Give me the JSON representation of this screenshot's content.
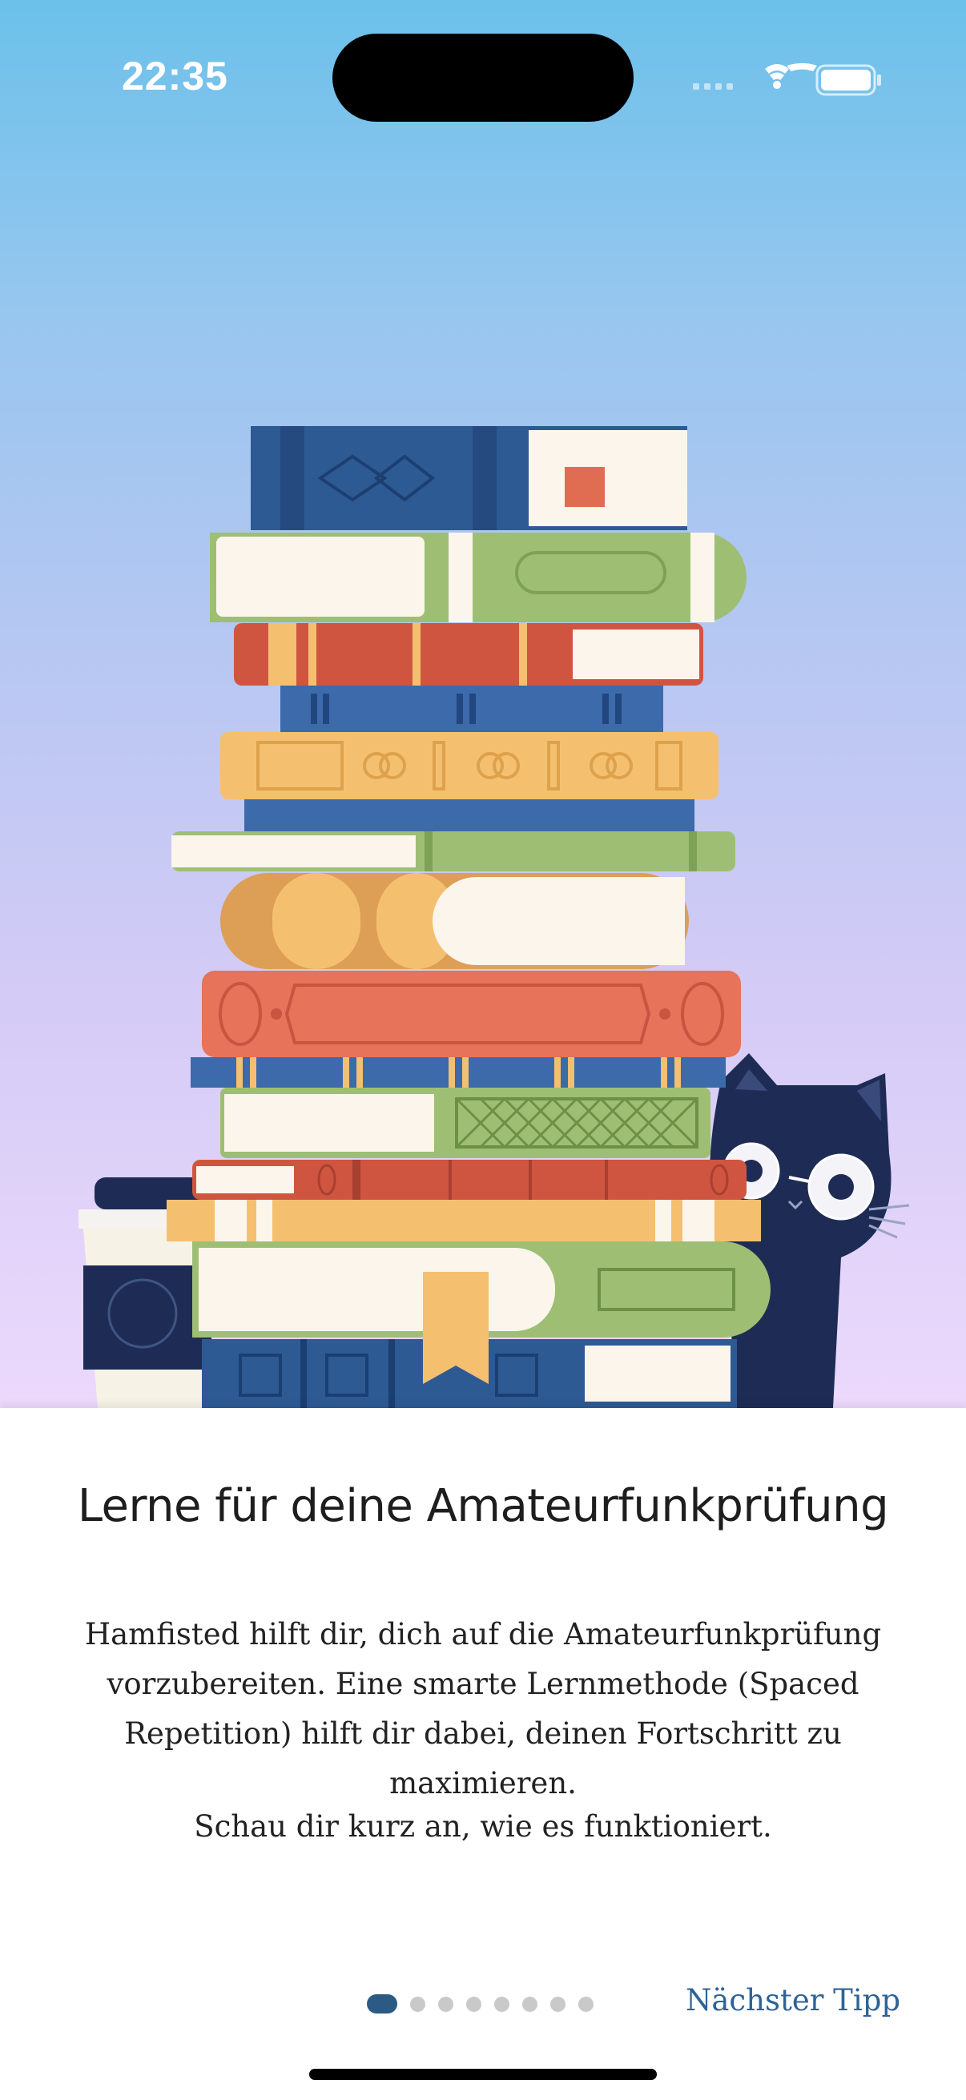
{
  "status_bar": {
    "time": "22:35",
    "icons": [
      "cellular-icon",
      "wifi-icon",
      "battery-icon"
    ]
  },
  "illustration": {
    "subject": "book-stack-with-cat"
  },
  "onboarding": {
    "title": "Lerne für deine Amateurfunkprüfung",
    "description": "Hamfisted hilft dir, dich auf die Amateurfunkprüfung vorzubereiten. Eine smarte Lernmethode (Spaced Repetition) hilft dir dabei, deinen Fortschritt zu maximieren.",
    "hint": "Schau dir kurz an, wie es funktioniert.",
    "page_count": 8,
    "current_page": 1,
    "next_label": "Nächster Tipp"
  },
  "colors": {
    "accent": "#2d6397",
    "pager_active": "#2b5a85",
    "pager_inactive": "#c9c9c9"
  }
}
